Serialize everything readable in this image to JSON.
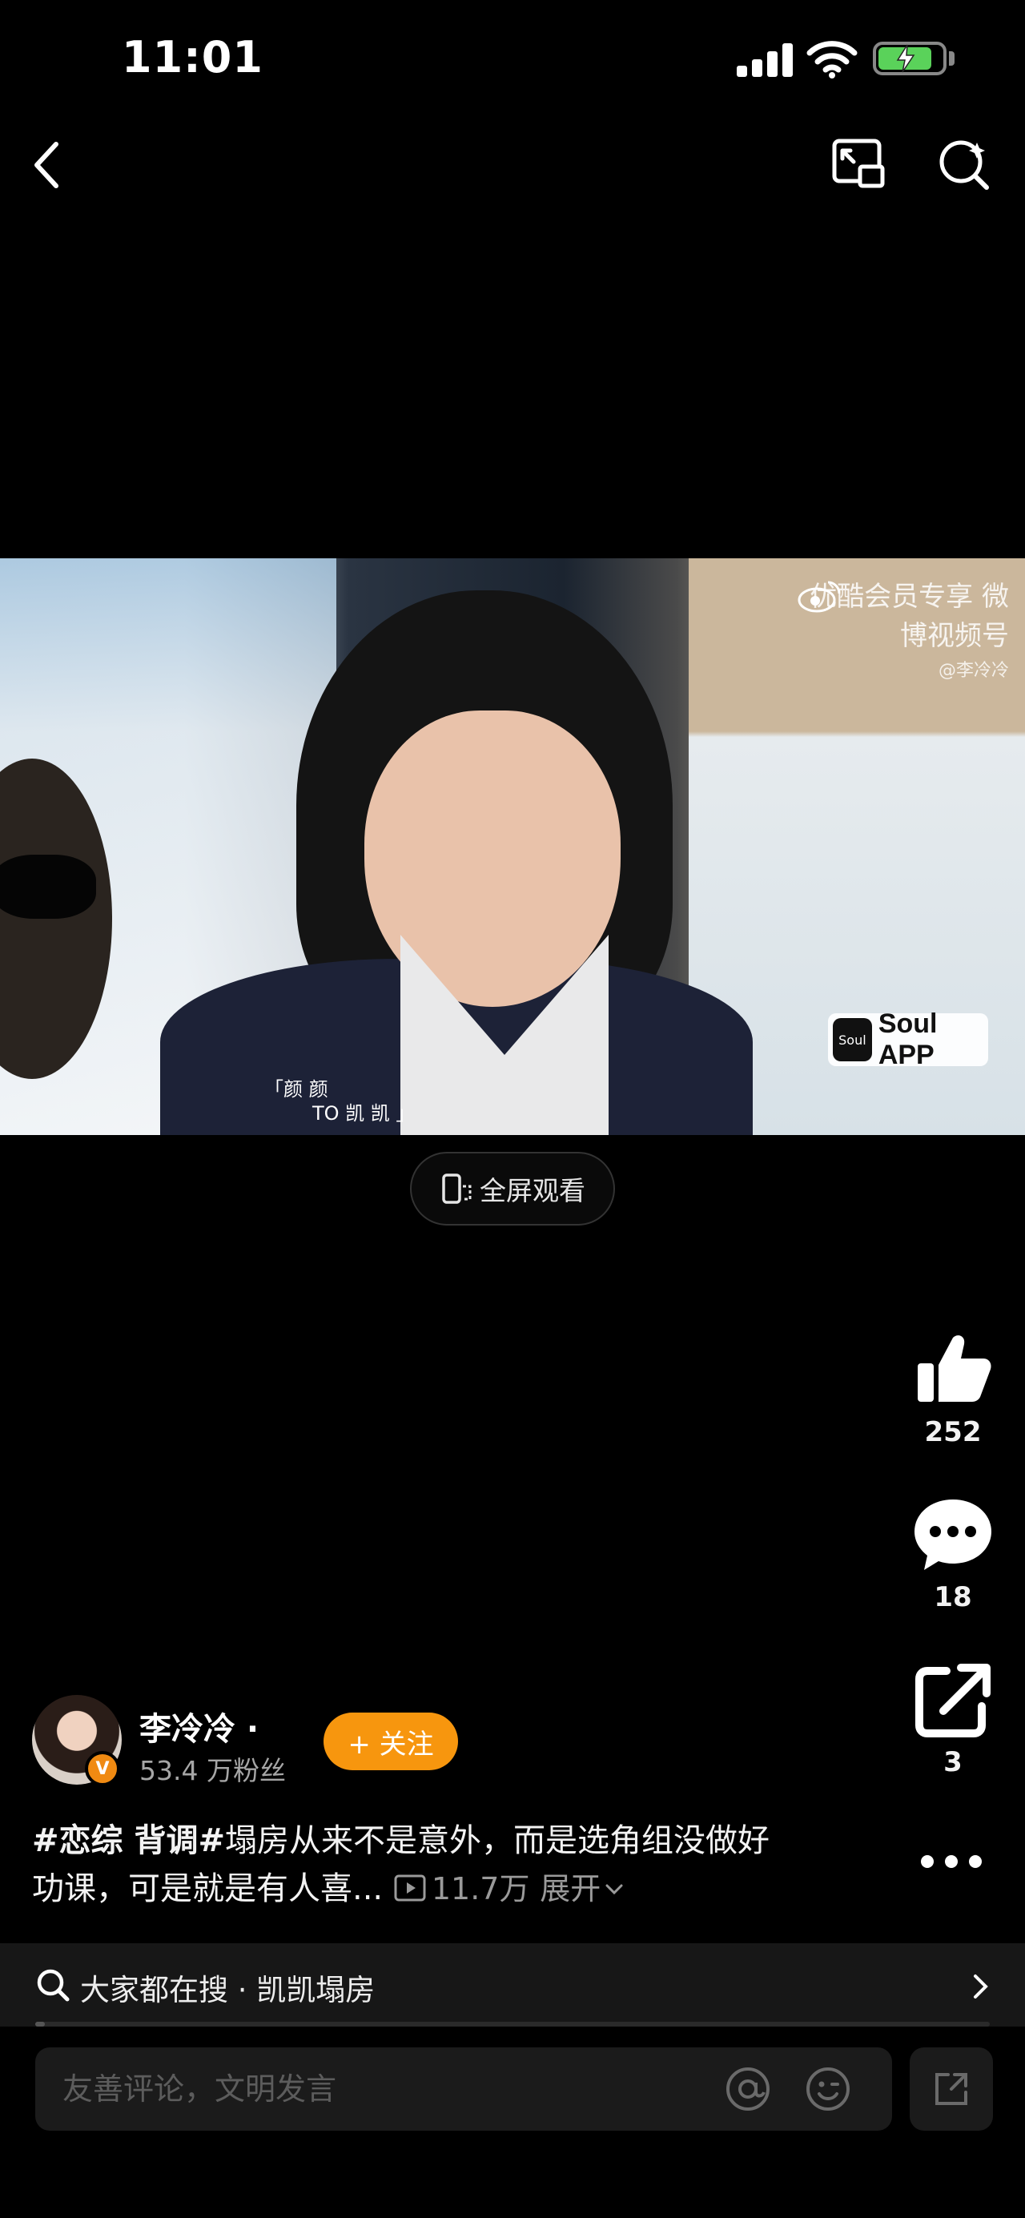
{
  "status_bar": {
    "time": "11:01"
  },
  "video": {
    "watermark_line1": "优酷会员专享 微博视频号",
    "watermark_line2": "@李冷冷",
    "soul_logo": "Soul",
    "soul_text": "Soul APP",
    "subtitle_line1": "「颜 颜",
    "subtitle_line2": "TO 凯 凯 」"
  },
  "fullscreen": {
    "label": "全屏观看"
  },
  "actions": {
    "like_count": "252",
    "comment_count": "18",
    "share_count": "3"
  },
  "author": {
    "name": "李冷冷 ·",
    "fans": "53.4 万粉丝",
    "verified_mark": "V",
    "follow_label": "+ 关注"
  },
  "caption": {
    "tag1": "#恋综 背调#",
    "text": "塌房从来不是意外，而是选角组没做好功课，可是就是有人喜...",
    "views": "11.7万",
    "expand_label": "展开"
  },
  "search": {
    "text": "大家都在搜 · 凯凯塌房"
  },
  "progress": {
    "fraction": 0.01
  },
  "comment_box": {
    "placeholder": "友善评论，文明发言"
  },
  "colors": {
    "accent": "#f7960e",
    "background": "#000000",
    "battery_fill": "#5ad25a"
  }
}
